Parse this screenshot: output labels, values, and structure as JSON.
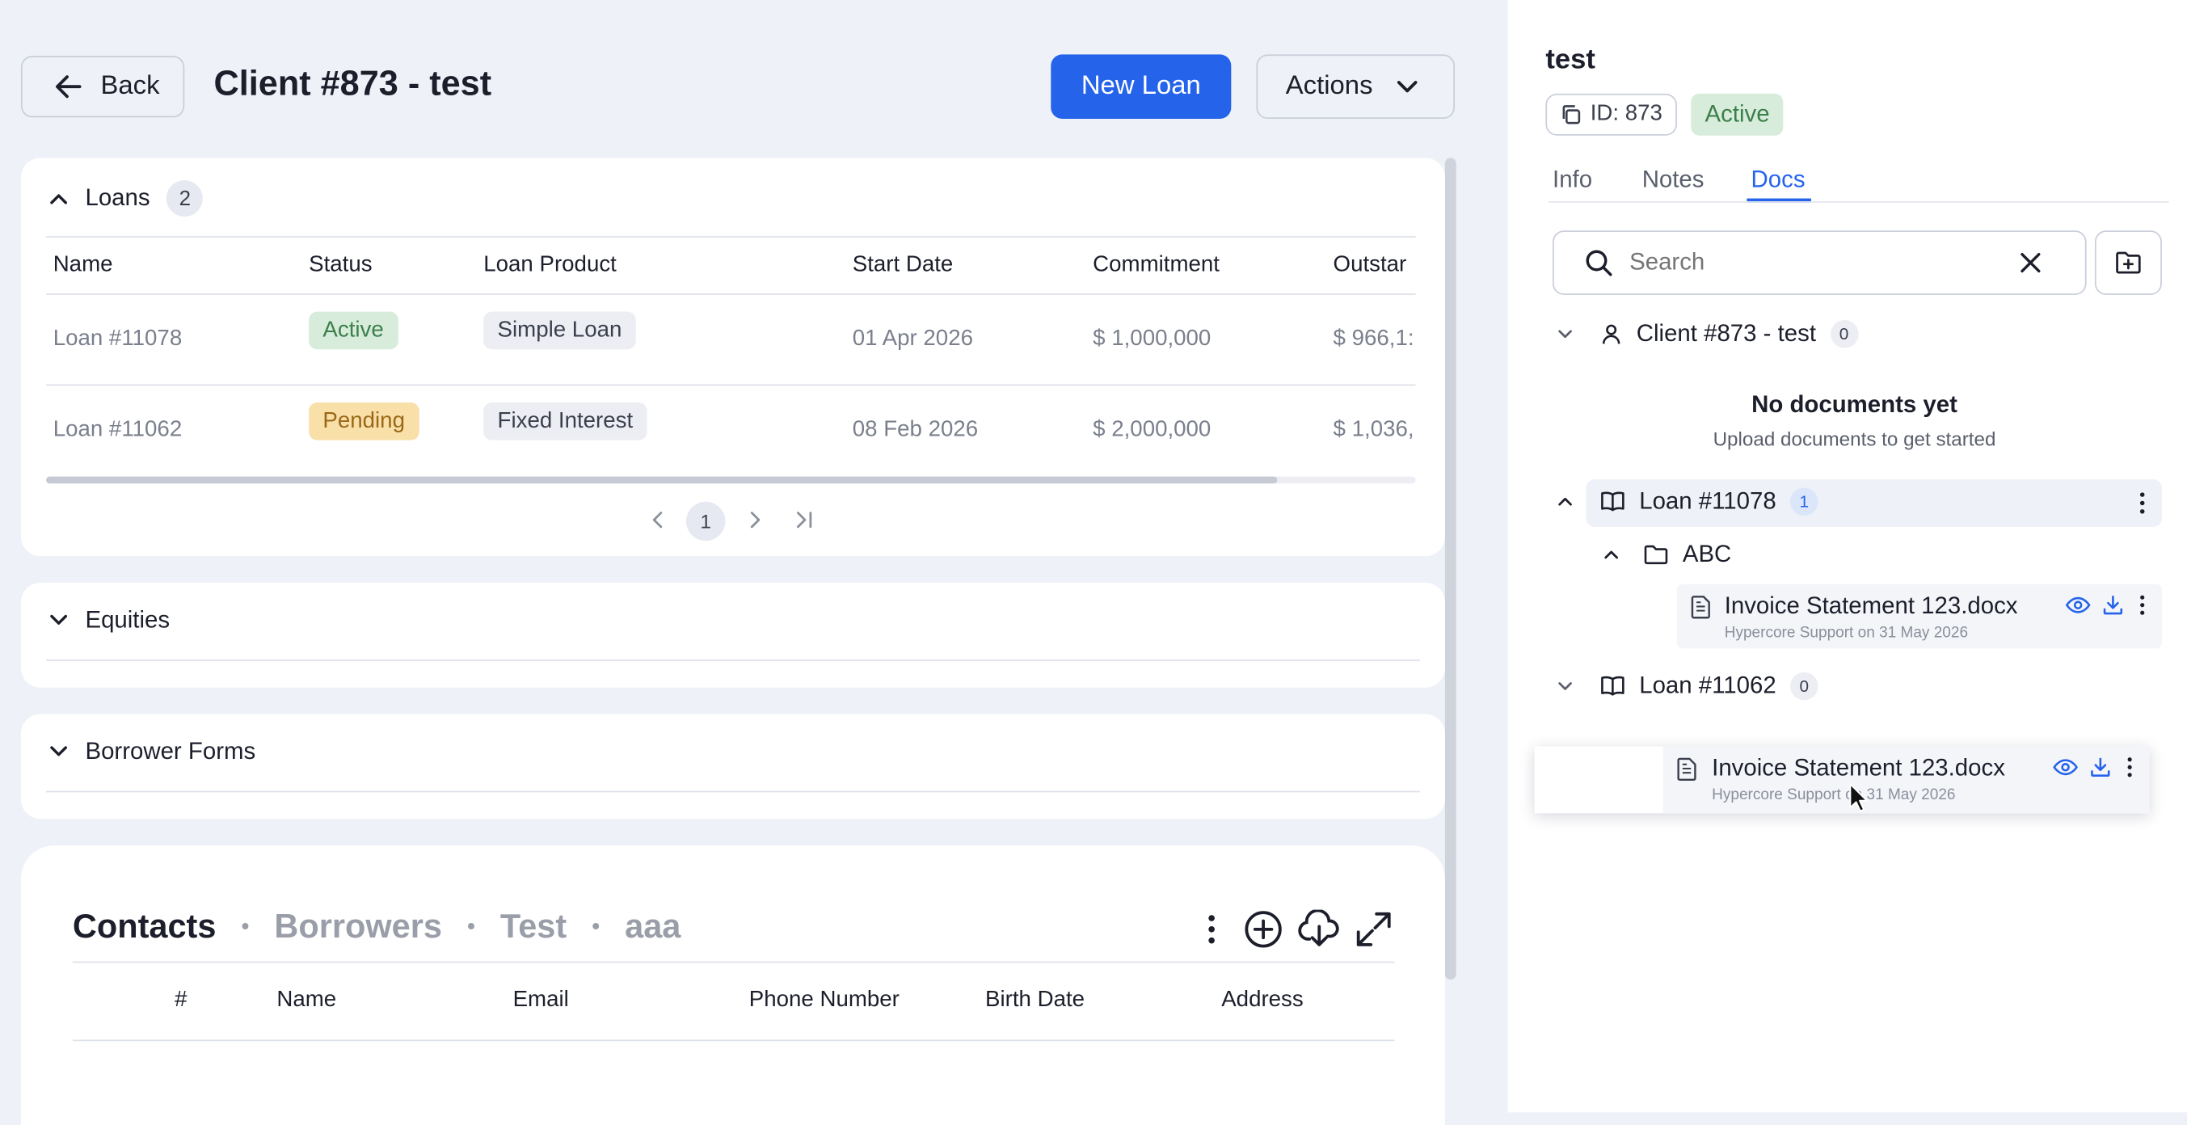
{
  "header": {
    "back_label": "Back",
    "title": "Client #873 - test",
    "new_loan_label": "New Loan",
    "actions_label": "Actions"
  },
  "loans": {
    "title": "Loans",
    "count": "2",
    "columns": [
      "Name",
      "Status",
      "Loan Product",
      "Start Date",
      "Commitment",
      "Outstar"
    ],
    "rows": [
      {
        "name": "Loan #11078",
        "status": "Active",
        "product": "Simple Loan",
        "start": "01 Apr 2026",
        "commitment": "$ 1,000,000",
        "outstanding": "$ 966,1:"
      },
      {
        "name": "Loan #11062",
        "status": "Pending",
        "product": "Fixed Interest",
        "start": "08 Feb 2026",
        "commitment": "$ 2,000,000",
        "outstanding": "$ 1,036,"
      }
    ],
    "page": "1"
  },
  "equities": {
    "title": "Equities"
  },
  "borrower_forms": {
    "title": "Borrower Forms"
  },
  "contacts": {
    "tabs": [
      "Contacts",
      "Borrowers",
      "Test",
      "aaa"
    ],
    "columns": [
      "#",
      "Name",
      "Email",
      "Phone Number",
      "Birth Date",
      "Address"
    ]
  },
  "panel": {
    "name": "test",
    "id_label": "ID: 873",
    "status": "Active",
    "tabs": [
      "Info",
      "Notes",
      "Docs"
    ],
    "active_tab": "Docs",
    "search_placeholder": "Search",
    "tree": {
      "client": {
        "label": "Client #873 - test",
        "count": "0"
      },
      "empty_title": "No documents yet",
      "empty_sub": "Upload documents to get started",
      "loan1": {
        "label": "Loan #11078",
        "count": "1"
      },
      "folder": "ABC",
      "doc": {
        "name": "Invoice Statement 123.docx",
        "meta": "Hypercore Support on 31 May 2026"
      },
      "loan2": {
        "label": "Loan #11062",
        "count": "0"
      },
      "drag_doc": {
        "name": "Invoice Statement 123.docx",
        "meta": "Hypercore Support on 31 May 2026"
      }
    }
  },
  "colors": {
    "accent": "#2563eb",
    "active_bg": "#d7ecdb",
    "pending_bg": "#f9dfa8",
    "page_bg": "#eef1f7"
  }
}
